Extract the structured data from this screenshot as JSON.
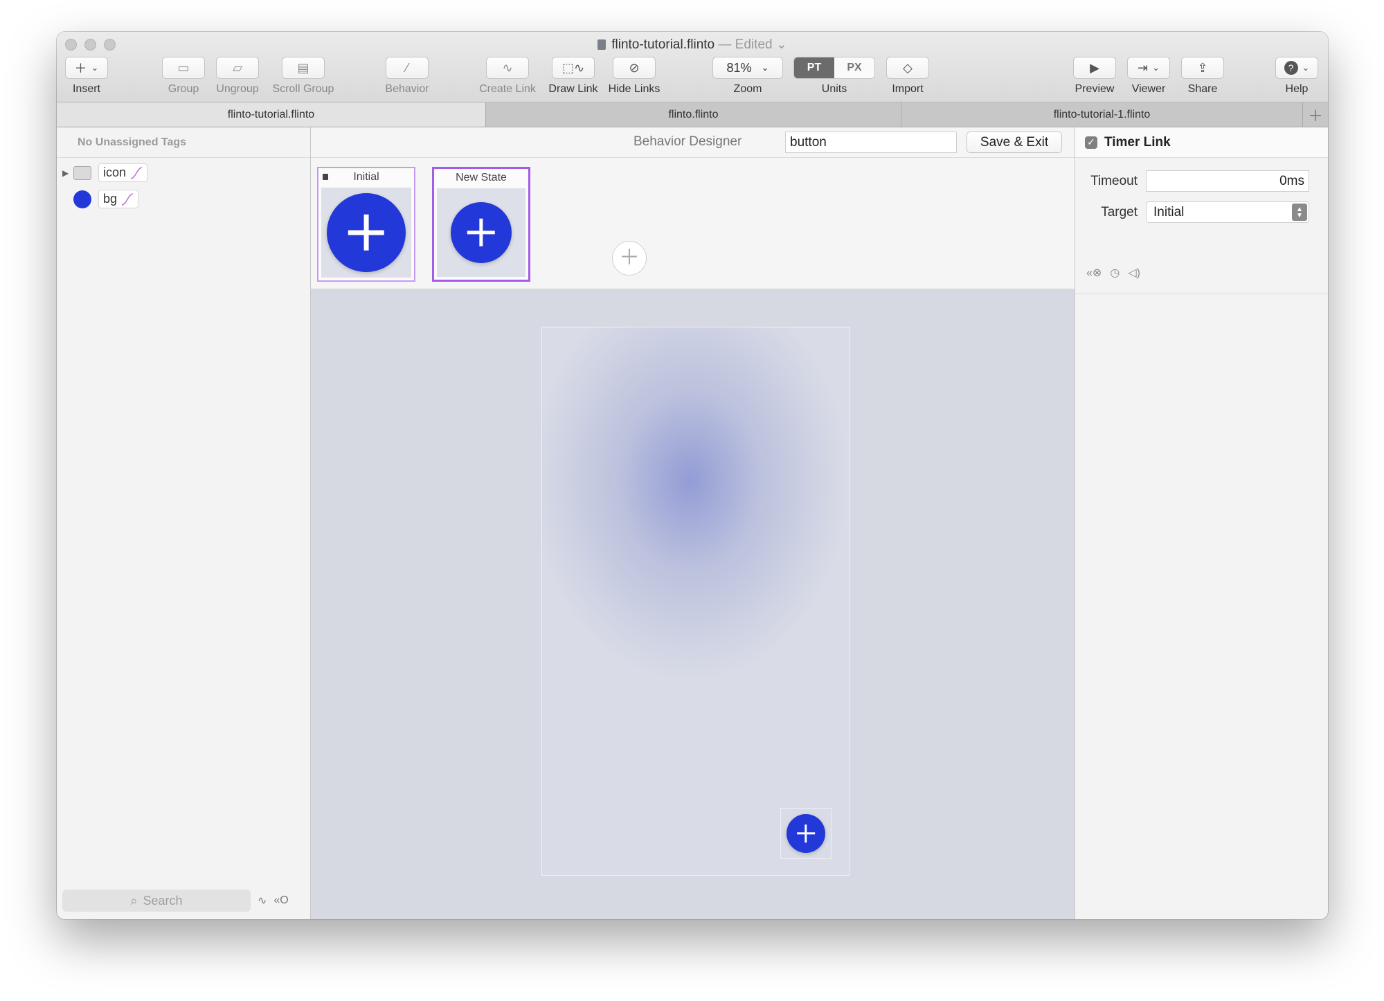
{
  "window": {
    "title": "flinto-tutorial.flinto",
    "edited": "— Edited"
  },
  "toolbar": {
    "insert": "Insert",
    "group": "Group",
    "ungroup": "Ungroup",
    "scroll_group": "Scroll Group",
    "behavior": "Behavior",
    "create_link": "Create Link",
    "draw_link": "Draw Link",
    "hide_links": "Hide Links",
    "zoom_value": "81%",
    "zoom": "Zoom",
    "units_pt": "PT",
    "units_px": "PX",
    "units": "Units",
    "import": "Import",
    "preview": "Preview",
    "viewer": "Viewer",
    "share": "Share",
    "help": "Help"
  },
  "tabs": [
    "flinto-tutorial.flinto",
    "flinto.flinto",
    "flinto-tutorial-1.flinto"
  ],
  "sidebar": {
    "tags_header": "No Unassigned Tags",
    "layers": [
      {
        "name": "icon"
      },
      {
        "name": "bg"
      }
    ],
    "search_placeholder": "Search"
  },
  "behavior_designer": {
    "title": "Behavior Designer",
    "name_value": "button",
    "save_exit": "Save & Exit",
    "states": [
      {
        "label": "Initial"
      },
      {
        "label": "New State"
      }
    ]
  },
  "inspector": {
    "title": "Timer Link",
    "timeout_label": "Timeout",
    "timeout_value": "0ms",
    "target_label": "Target",
    "target_value": "Initial"
  },
  "colors": {
    "accent_blue": "#2338d8",
    "state_border": "#a45ce8"
  }
}
